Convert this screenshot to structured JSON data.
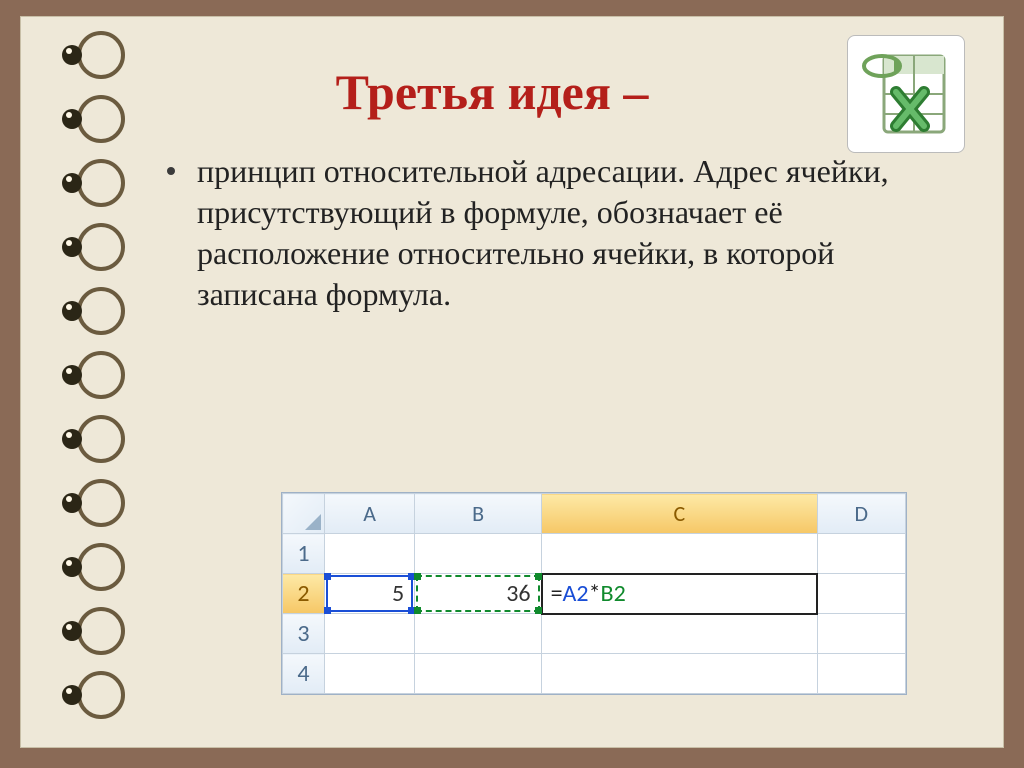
{
  "title": "Третья идея –",
  "bullet": "принцип относительной адресации. Адрес ячейки, присутствующий в формуле, обозначает её расположение относительно ячейки, в которой записана формула.",
  "excel": {
    "columns": [
      "A",
      "B",
      "C",
      "D"
    ],
    "rows": [
      "1",
      "2",
      "3",
      "4"
    ],
    "active_row": "2",
    "active_col": "C",
    "cells": {
      "A2": "5",
      "B2": "36",
      "C2_formula_eq": "=",
      "C2_formula_ref1": "A2",
      "C2_formula_op": "*",
      "C2_formula_ref2": "B2"
    }
  }
}
